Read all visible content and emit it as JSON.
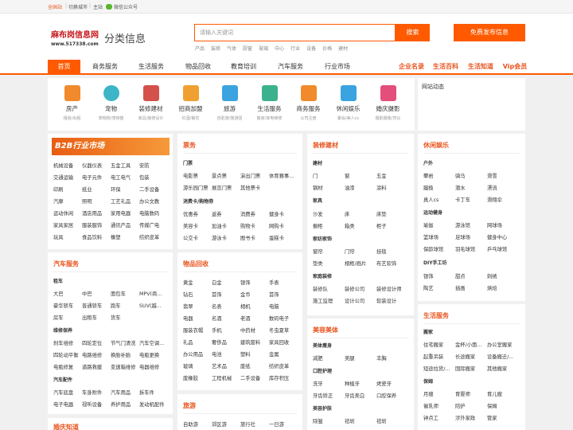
{
  "topbar": {
    "site": "全国站",
    "switch": "切换城市",
    "main": "主站",
    "wechat": "微信公众号"
  },
  "logo": {
    "name": "麻布岗信息网",
    "url": "www.517338.com",
    "tagline": "分类信息"
  },
  "search": {
    "placeholder": "请输入关键词",
    "button": "搜索",
    "hot": [
      "产品",
      "装修",
      "气体",
      "厨窗",
      "玻璃",
      "中心",
      "行业",
      "设备",
      "价格",
      "建材"
    ]
  },
  "post_button": "免费发布信息",
  "nav": {
    "items": [
      "首页",
      "商务服务",
      "生活服务",
      "物品回收",
      "教育培训",
      "汽车服务",
      "行业市场"
    ],
    "right": [
      "企业名录",
      "生活百科",
      "生活知道",
      "Vip会员"
    ]
  },
  "categories": [
    {
      "name": "房产",
      "sub": "租房/出租",
      "icon": "house-icon",
      "color": "#f08a2c"
    },
    {
      "name": "宠物",
      "sub": "宠物狗/宠物猫",
      "icon": "paw-icon",
      "color": "#3db5c6"
    },
    {
      "name": "装修建材",
      "sub": "家具/装修设计",
      "icon": "brick-wall-icon",
      "color": "#d4504a"
    },
    {
      "name": "招商加盟",
      "sub": "红酒/餐饮",
      "icon": "handshake-icon",
      "color": "#f0a030"
    },
    {
      "name": "旅游",
      "sub": "自助游/旅游团",
      "icon": "plane-icon",
      "color": "#3aa3e0"
    },
    {
      "name": "生活服务",
      "sub": "搬家/家电维修",
      "icon": "service-icon",
      "color": "#3bb28d"
    },
    {
      "name": "商务服务",
      "sub": "公司注册",
      "icon": "briefcase-icon",
      "color": "#f08a2c"
    },
    {
      "name": "休闲娱乐",
      "sub": "聚会/美人cs",
      "icon": "glasses-icon",
      "color": "#3aa3e0"
    },
    {
      "name": "婚庆摄影",
      "sub": "摄影摄像/司仪",
      "icon": "camera-icon",
      "color": "#e44e7a"
    }
  ],
  "news": {
    "title": "网站动态"
  },
  "b2b": {
    "banner": "B2B行业市场",
    "rows": [
      [
        "机械设备",
        "仪器仪表",
        "五金工具",
        "安防"
      ],
      [
        "交通运输",
        "电子元件",
        "电工电气",
        "包装"
      ],
      [
        "印刷",
        "纸业",
        "环保",
        "二手设备"
      ],
      [
        "汽摩",
        "照明",
        "工艺礼品",
        "办公文教"
      ],
      [
        "运动休闲",
        "酒店用品",
        "家用电器",
        "电脑数码"
      ],
      [
        "家具家居",
        "服装服饰",
        "通讯产品",
        "传媒广电"
      ],
      [
        "玩具",
        "食品饮料",
        "橡塑",
        "纺织皮革"
      ]
    ]
  },
  "piaowu": {
    "title": "票务",
    "sec1": "门票",
    "rows1": [
      [
        "电影票",
        "景点票",
        "演出门票",
        "体育赛事..."
      ],
      [
        "游乐园门票",
        "展览门票",
        "其他票卡"
      ]
    ],
    "sec2": "消费卡/购物券",
    "rows2": [
      [
        "优惠券",
        "返券",
        "消费券",
        "健身卡"
      ],
      [
        "美容卡",
        "加油卡",
        "购物卡",
        "网购卡"
      ],
      [
        "公交卡",
        "游泳卡",
        "图书卡",
        "蛋糕卡"
      ]
    ]
  },
  "zxjc": {
    "title": "装修建材",
    "sec1": "建材",
    "rows1": [
      [
        "门",
        "窗",
        "五金"
      ],
      [
        "钢材",
        "油漆",
        "涂料"
      ]
    ],
    "sec2": "家具",
    "rows2": [
      [
        "沙发",
        "床",
        "床垫"
      ],
      [
        "橱柜",
        "箱类",
        "柜子"
      ]
    ],
    "sec3": "家纺家饰",
    "rows3": [
      [
        "窗帘",
        "门帘",
        "挂毯"
      ],
      [
        "垫类",
        "相框/画片",
        "布艺软饰"
      ]
    ],
    "sec4": "家庭装修",
    "rows4": [
      [
        "装修队",
        "装修公司",
        "装修设计师"
      ],
      [
        "施工监理",
        "设计公司",
        "软装设计"
      ]
    ]
  },
  "xxyl": {
    "title": "休闲娱乐",
    "sec1": "户外",
    "rows1": [
      [
        "攀岩",
        "骑马",
        "滑雪"
      ],
      [
        "蹦极",
        "潜水",
        "漂流"
      ],
      [
        "真人cs",
        "卡丁车",
        "滑翔伞"
      ]
    ],
    "sec2": "运动健身",
    "rows2": [
      [
        "瑜伽",
        "游泳馆",
        "网球场"
      ],
      [
        "篮球场",
        "足球场",
        "健身中心"
      ],
      [
        "保龄球馆",
        "羽毛球馆",
        "乒乓球馆"
      ]
    ],
    "sec3": "DIY手工坊",
    "rows3": [
      [
        "银饰",
        "甜点",
        "刺绣"
      ],
      [
        "陶艺",
        "插画",
        "烘焙"
      ]
    ]
  },
  "qcfw": {
    "title": "汽车服务",
    "sec1": "租车",
    "rows1": [
      [
        "大巴",
        "中巴",
        "面包车",
        "MPV(商..."
      ],
      [
        "豪华轿车",
        "普通轿车",
        "跑车",
        "SUV(越..."
      ],
      [
        "房车",
        "出租车",
        "货车"
      ]
    ],
    "sec2": "维修保养",
    "rows2": [
      [
        "刹车维修",
        "四轮定位",
        "节气门清洗",
        "汽车空调..."
      ],
      [
        "四轮动平衡",
        "电路维修",
        "换胎补胎",
        "电瓶更换"
      ],
      [
        "电瓶修复",
        "道路救援",
        "变速箱维修",
        "电器维修"
      ]
    ],
    "sec3": "汽车配件",
    "rows3": [
      [
        "汽车底盘",
        "车身附件",
        "汽车用品",
        "拆车件"
      ],
      [
        "电子电器",
        "视听设备",
        "养护用品",
        "发动机配件"
      ]
    ]
  },
  "wphs": {
    "title": "物品回收",
    "rows": [
      [
        "黄金",
        "白金",
        "银饰",
        "手表"
      ],
      [
        "钻石",
        "首饰",
        "金币",
        "首饰"
      ],
      [
        "翡翠",
        "名表",
        "相机",
        "电脑"
      ],
      [
        "电器",
        "名酒",
        "老酒",
        "数码电子"
      ],
      [
        "服装衣帽",
        "手机",
        "中药材",
        "冬虫夏草"
      ],
      [
        "礼品",
        "奢侈品",
        "建筑废料",
        "家具回收"
      ],
      [
        "办公用品",
        "电池",
        "塑料",
        "金属"
      ],
      [
        "玻璃",
        "艺术品",
        "废纸",
        "纺织皮革"
      ],
      [
        "废橡胶",
        "工程机械",
        "二手设备",
        "库存积压"
      ]
    ]
  },
  "lvyou": {
    "title": "旅游",
    "rows": [
      [
        "自助游",
        "郊区游",
        "旅行社",
        "一日游"
      ]
    ]
  },
  "mrmt": {
    "title": "美容美体",
    "sec1": "美体瘦身",
    "rows1": [
      [
        "减肥",
        "美腿",
        "丰胸"
      ]
    ],
    "sec2": "口腔护理",
    "rows2": [
      [
        "洗牙",
        "种植牙",
        "烤瓷牙"
      ],
      [
        "牙齿矫正",
        "牙齿美白",
        "口腔保养"
      ]
    ],
    "sec3": "美容护肤",
    "rows3": [
      [
        "除皱",
        "祛斑",
        "祛斑"
      ]
    ]
  },
  "shfw": {
    "title": "生活服务",
    "sec1": "搬家",
    "rows1": [
      [
        "住宅搬家",
        "金杯/小面...",
        "办公室搬家"
      ],
      [
        "起重吊装",
        "长途搬家",
        "设备搬迁/..."
      ],
      [
        "短途拉货/...",
        "国际搬家",
        "其他搬家"
      ]
    ],
    "sec2": "保姆",
    "rows2": [
      [
        "月嫂",
        "育婴师",
        "育儿嫂"
      ],
      [
        "催乳师",
        "陪护",
        "保姆"
      ],
      [
        "钟点工",
        "涉外家政",
        "管家"
      ]
    ]
  },
  "left_bottom": {
    "title": "婚庆知道"
  }
}
